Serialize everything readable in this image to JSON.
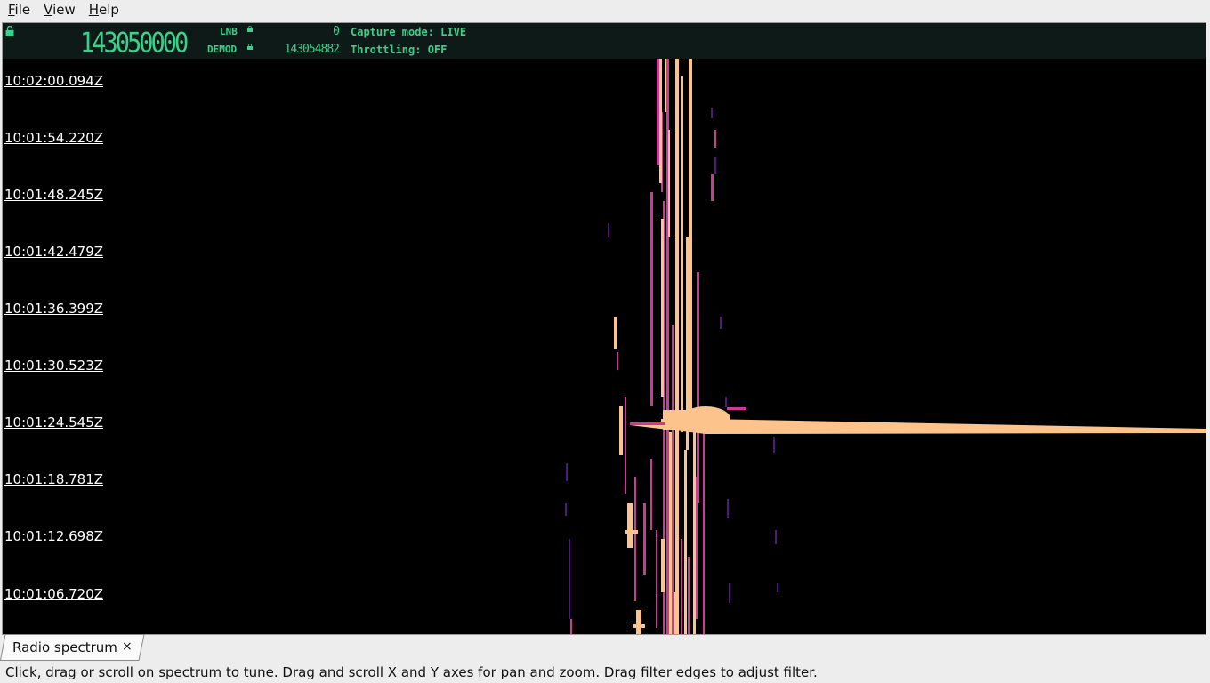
{
  "menu": {
    "file": {
      "accel": "F",
      "rest": "ile"
    },
    "view": {
      "accel": "V",
      "rest": "iew"
    },
    "help": {
      "accel": "H",
      "rest": "elp"
    }
  },
  "header": {
    "frequency": "143050000",
    "lnb_label": "LNB",
    "lnb_value": "0",
    "demod_label": "DEMOD",
    "demod_value": "143054882",
    "capture_mode": "Capture mode: LIVE",
    "throttling": "Throttling: OFF"
  },
  "colors": {
    "accent_green": "#39d18c",
    "header_bg": "#0e1a17",
    "signal_hot": "#fcc48c",
    "signal_mid": "#c83c96",
    "signal_low": "#5a1a8c"
  },
  "waterfall": {
    "timestamps": [
      "10:02:00.094Z",
      "10:01:54.220Z",
      "10:01:48.245Z",
      "10:01:42.479Z",
      "10:01:36.399Z",
      "10:01:30.523Z",
      "10:01:24.545Z",
      "10:01:18.781Z",
      "10:01:12.698Z",
      "10:01:06.720Z"
    ]
  },
  "tabs": [
    {
      "label": "Radio spectrum",
      "close": "×"
    }
  ],
  "status": "Click, drag or scroll on spectrum to tune. Drag and scroll X and Y axes for pan and zoom. Drag filter edges to adjust filter."
}
